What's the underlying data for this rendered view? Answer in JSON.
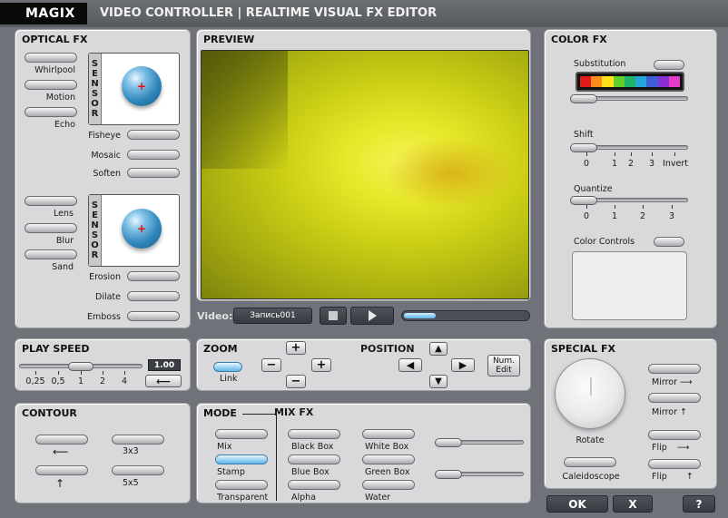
{
  "app": {
    "logo": "MAGIX",
    "title": "VIDEO CONTROLLER | REALTIME VISUAL FX EDITOR"
  },
  "optical_fx": {
    "title": "OPTICAL FX",
    "sensor_label": "SENSOR",
    "left_top": [
      "Whirlpool",
      "Motion",
      "Echo"
    ],
    "right_top": [
      "Fisheye",
      "Mosaic",
      "Soften"
    ],
    "left_bottom": [
      "Lens",
      "Blur",
      "Sand"
    ],
    "right_bottom": [
      "Erosion",
      "Dilate",
      "Emboss"
    ]
  },
  "preview": {
    "title": "PREVIEW",
    "video_label": "Video:",
    "video_name": "Запись001",
    "progress": 0.25
  },
  "color_fx": {
    "title": "COLOR FX",
    "substitution": "Substitution",
    "palette": [
      "#e01b1b",
      "#ff8c1a",
      "#ffe31a",
      "#5fd12a",
      "#1fb26b",
      "#23a7d8",
      "#3c5fd6",
      "#8a2fd1",
      "#e43bc8"
    ],
    "shift": "Shift",
    "shift_ticks": [
      "0",
      "1",
      "2",
      "3",
      "Invert"
    ],
    "quantize": "Quantize",
    "quantize_ticks": [
      "0",
      "1",
      "2",
      "3"
    ],
    "color_controls": "Color Controls"
  },
  "play_speed": {
    "title": "PLAY SPEED",
    "value": "1.00",
    "ticks": [
      "0,25",
      "0,5",
      "1",
      "2",
      "4"
    ]
  },
  "zoom": {
    "title": "ZOOM",
    "link": "Link",
    "plus": "+",
    "minus": "−"
  },
  "position": {
    "title": "POSITION",
    "num_edit": "Num. Edit"
  },
  "special_fx": {
    "title": "SPECIAL FX",
    "rotate": "Rotate",
    "caleidoscope": "Caleidoscope",
    "mirror": "Mirror",
    "flip": "Flip"
  },
  "contour": {
    "title": "CONTOUR",
    "b1": "3x3",
    "b2": "5x5"
  },
  "mode": {
    "title": "MODE",
    "mix_fx": "MIX FX",
    "col1": [
      "Mix",
      "Stamp",
      "Transparent"
    ],
    "col2": [
      "Black Box",
      "Blue Box",
      "Alpha"
    ],
    "col3": [
      "White Box",
      "Green Box",
      "Water"
    ]
  },
  "footer": {
    "ok": "OK",
    "x": "X",
    "help": "?"
  }
}
